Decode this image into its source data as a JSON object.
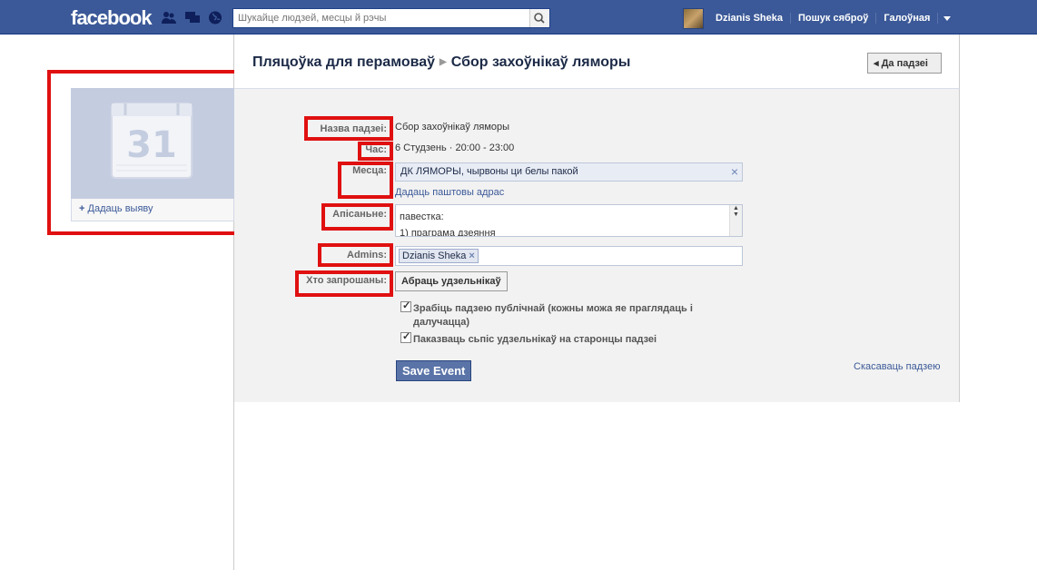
{
  "topbar": {
    "logo": "facebook",
    "search_placeholder": "Шукайце людзей, месцы й рэчы",
    "user_name": "Dzianis Sheka",
    "find_friends": "Пошук сяброў",
    "home": "Галоўная"
  },
  "left": {
    "calendar_day": "31",
    "add_photo": "Дадаць выяву"
  },
  "header": {
    "crumb_parent": "Пляцоўка для перамоваў",
    "crumb_current": "Сбор захоўнікаў ляморы",
    "back_label": "Да падзеі"
  },
  "form": {
    "name_label": "Назва падзеі:",
    "name_value": "Сбор захоўнікаў ляморы",
    "time_label": "Час:",
    "time_value": "6 Студзень · 20:00 - 23:00",
    "place_label": "Месца:",
    "place_value": "ДК ЛЯМОРЫ, чырвоны ци белы пакой",
    "add_address": "Дадаць паштовы адрас",
    "desc_label": "Апісаньне:",
    "desc_line1": "павестка:",
    "desc_line2": "1) праграма дзеяння",
    "admins_label": "Admins:",
    "admin_token": "Dzianis Sheka",
    "invited_label": "Хто запрошаны:",
    "choose_guests": "Абраць удзельнікаў",
    "public_checkbox": "Зрабіць падзею публічнай (кожны можа яе праглядаць і далучацца)",
    "show_guests_checkbox": "Паказваць сьпіс удзельнікаў на старонцы падзеі",
    "save_button": "Save Event",
    "cancel_event": "Скасаваць падзею"
  },
  "colors": {
    "brand": "#3b5998",
    "highlight": "#e01010"
  }
}
